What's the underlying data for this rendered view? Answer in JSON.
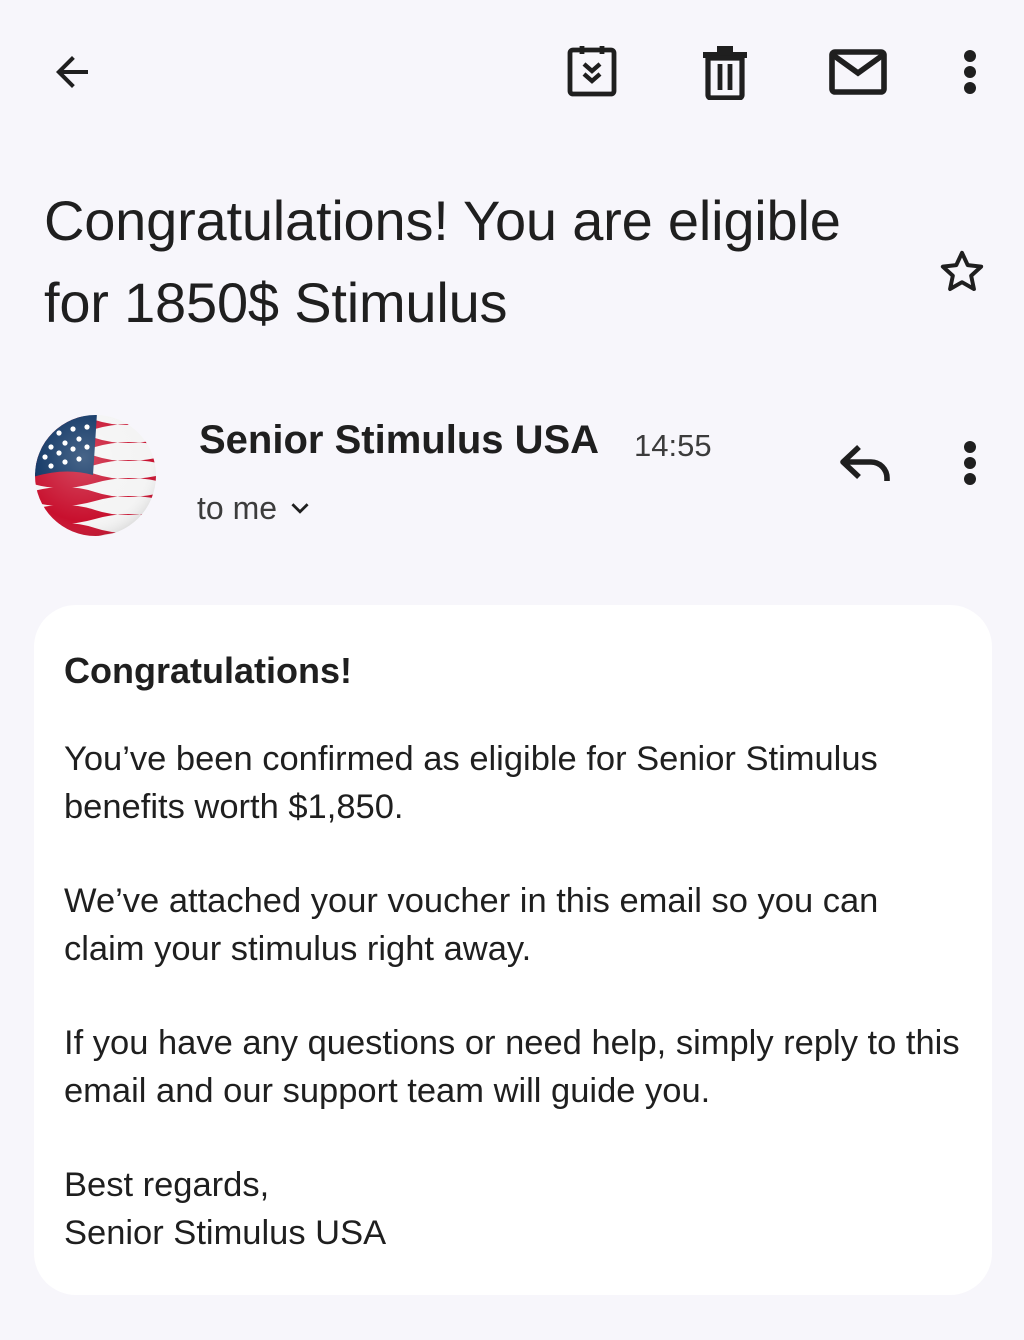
{
  "toolbar": {
    "back_icon": "arrow-left-icon",
    "archive_icon": "archive-icon",
    "delete_icon": "trash-icon",
    "mark_unread_icon": "mail-icon",
    "more_icon": "more-vert-icon"
  },
  "email": {
    "subject": "Congratulations! You are eligible for 1850$ Stimulus",
    "starred": false,
    "sender": {
      "name": "Senior Stimulus USA",
      "avatar": "us-flag-avatar",
      "time": "14:55",
      "recipient_label": "to me"
    },
    "body": {
      "greeting": "Congratulations!",
      "paragraphs": [
        "You’ve been confirmed as eligible for Senior Stimulus benefits worth $1,850.",
        "We’ve attached your voucher in this email so you can claim your stimulus right away.",
        "If you have any questions or need help, simply reply to this email and our support team will guide you."
      ],
      "closing": "Best regards,",
      "signature": "Senior Stimulus USA"
    }
  },
  "colors": {
    "background": "#f7f6fb",
    "card": "#ffffff",
    "text": "#1f1f1f",
    "icon": "#1f1f1f",
    "flag_red": "#c8102e",
    "flag_blue": "#0a3161"
  }
}
